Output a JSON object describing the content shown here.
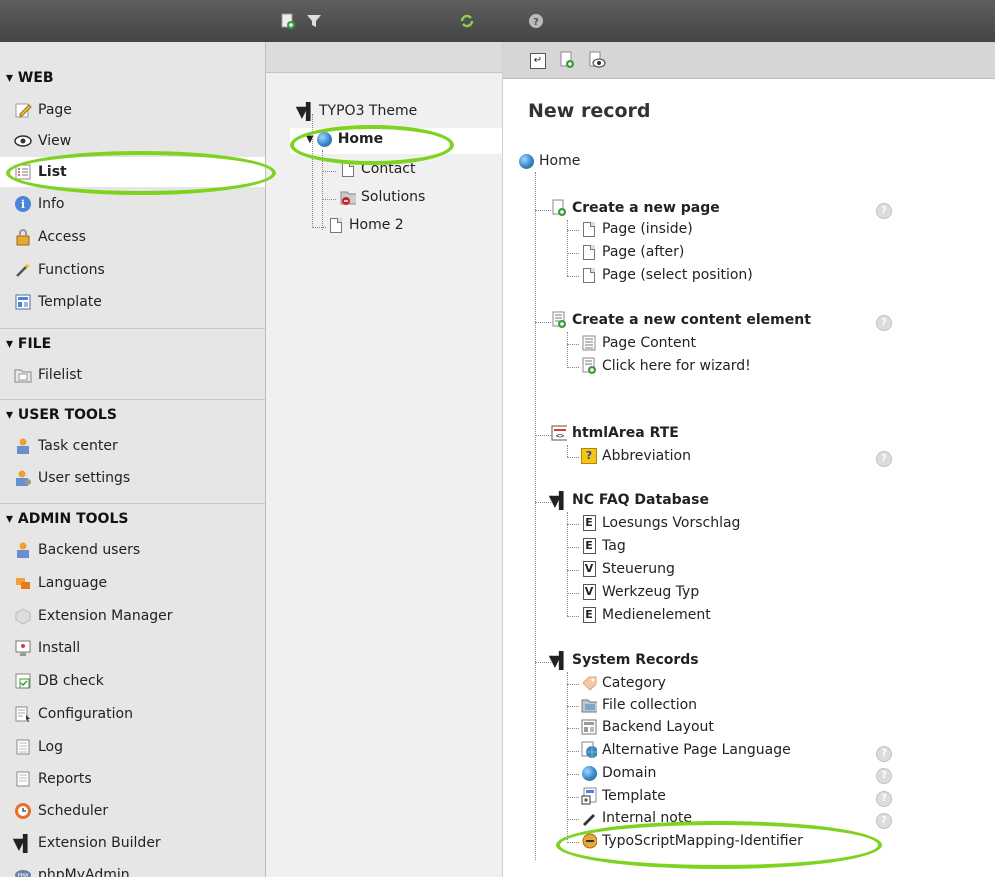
{
  "sidebar": {
    "sections": [
      {
        "title": "▾ WEB",
        "items": [
          "Page",
          "View",
          "List",
          "Info",
          "Access",
          "Functions",
          "Template"
        ]
      },
      {
        "title": "▾ FILE",
        "items": [
          "Filelist"
        ]
      },
      {
        "title": "▾ USER TOOLS",
        "items": [
          "Task center",
          "User settings"
        ]
      },
      {
        "title": "▾ ADMIN TOOLS",
        "items": [
          "Backend users",
          "Language",
          "Extension Manager",
          "Install",
          "DB check",
          "Configuration",
          "Log",
          "Reports",
          "Scheduler",
          "Extension Builder",
          "phpMyAdmin"
        ]
      }
    ],
    "active": "List"
  },
  "tree": {
    "root": "TYPO3 Theme",
    "home": "Home",
    "contact": "Contact",
    "solutions": "Solutions",
    "home2": "Home 2"
  },
  "content": {
    "title": "New record",
    "page": "Home",
    "new_page": {
      "title": "Create a new page",
      "items": [
        "Page (inside)",
        "Page (after)",
        "Page (select position)"
      ]
    },
    "new_content": {
      "title": "Create a new content element",
      "items": [
        "Page Content",
        "Click here for wizard!"
      ]
    },
    "rte": {
      "title": "htmlArea RTE",
      "items": [
        "Abbreviation"
      ]
    },
    "faq": {
      "title": "NC FAQ Database",
      "items": [
        "Loesungs Vorschlag",
        "Tag",
        "Steuerung",
        "Werkzeug Typ",
        "Medienelement"
      ],
      "letters": [
        "E",
        "E",
        "V",
        "V",
        "E"
      ]
    },
    "system": {
      "title": "System Records",
      "items": [
        "Category",
        "File collection",
        "Backend Layout",
        "Alternative Page Language",
        "Domain",
        "Template",
        "Internal note",
        "TypoScriptMapping-Identifier"
      ]
    }
  },
  "colors": {
    "highlight_ring": "#7ed321",
    "topbar": "#4a4a4a"
  }
}
